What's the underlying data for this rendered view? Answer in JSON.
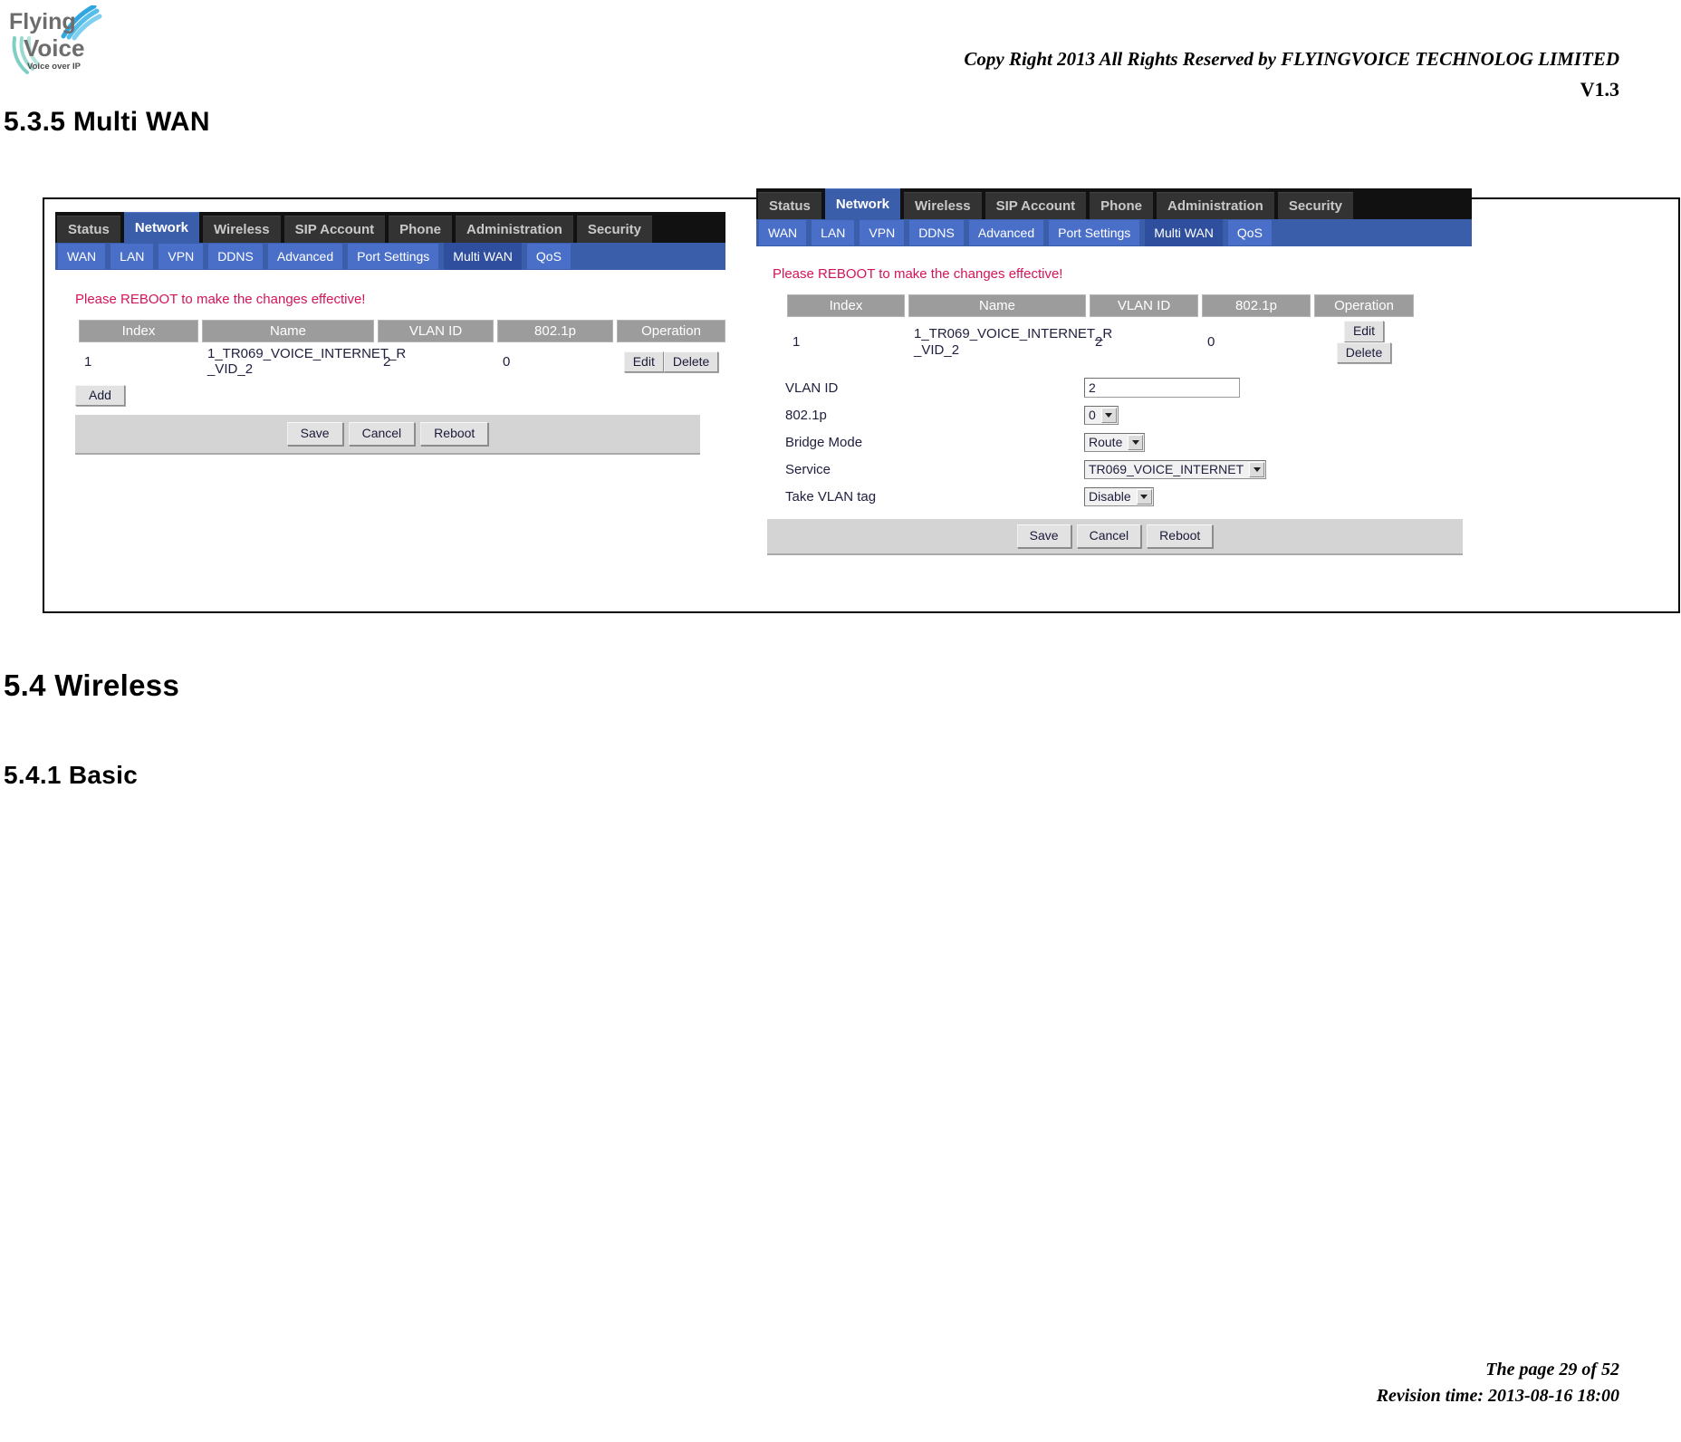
{
  "header": {
    "copyright": "Copy Right 2013 All Rights Reserved by FLYINGVOICE TECHNOLOG LIMITED",
    "version": "V1.3",
    "logo_line1": "Flying",
    "logo_line2": "Voice",
    "logo_tagline": "Voice over IP"
  },
  "headings": {
    "multi_wan": "5.3.5 Multi WAN",
    "wireless": "5.4  Wireless",
    "basic": "5.4.1 Basic"
  },
  "router_ui": {
    "main_tabs": [
      {
        "label": "Status",
        "active": false
      },
      {
        "label": "Network",
        "active": true
      },
      {
        "label": "Wireless",
        "active": false
      },
      {
        "label": "SIP Account",
        "active": false
      },
      {
        "label": "Phone",
        "active": false
      },
      {
        "label": "Administration",
        "active": false
      },
      {
        "label": "Security",
        "active": false
      }
    ],
    "sub_tabs": [
      {
        "label": "WAN",
        "active": false
      },
      {
        "label": "LAN",
        "active": false
      },
      {
        "label": "VPN",
        "active": false
      },
      {
        "label": "DDNS",
        "active": false
      },
      {
        "label": "Advanced",
        "active": false
      },
      {
        "label": "Port Settings",
        "active": false
      },
      {
        "label": "Multi WAN",
        "active": true
      },
      {
        "label": "QoS",
        "active": false
      }
    ],
    "reboot_message": "Please REBOOT to make the changes effective!",
    "table": {
      "columns": [
        "Index",
        "Name",
        "VLAN ID",
        "802.1p",
        "Operation"
      ],
      "rows": [
        {
          "index": "1",
          "name": "1_TR069_VOICE_INTERNET_R_VID_2",
          "name_line1": "1_TR069_VOICE_INTERNET_R",
          "name_line2": "_VID_2",
          "vlan_id": "2",
          "dot1p": "0",
          "edit_label": "Edit",
          "delete_label": "Delete"
        }
      ]
    },
    "add_label": "Add",
    "action_buttons": [
      "Save",
      "Cancel",
      "Reboot"
    ],
    "edit_form": {
      "fields": [
        {
          "label": "VLAN ID",
          "type": "text",
          "value": "2"
        },
        {
          "label": "802.1p",
          "type": "select",
          "value": "0"
        },
        {
          "label": "Bridge Mode",
          "type": "select",
          "value": "Route"
        },
        {
          "label": "Service",
          "type": "select",
          "value": "TR069_VOICE_INTERNET"
        },
        {
          "label": "Take VLAN tag",
          "type": "select",
          "value": "Disable"
        }
      ]
    }
  },
  "colors": {
    "nav_top_bg": "#111111",
    "nav_tab_bg": "#333333",
    "nav_active_blue": "#3b5eab",
    "sub_tab_blue": "#4a6fc9",
    "sub_tab_active": "#2f4f9e",
    "table_header_gray": "#9c9c9c",
    "action_bar_gray": "#d4d4d4",
    "warning_red": "#d4145a"
  },
  "footer": {
    "page": "The page 29 of 52",
    "revision": "Revision time: 2013-08-16 18:00"
  }
}
